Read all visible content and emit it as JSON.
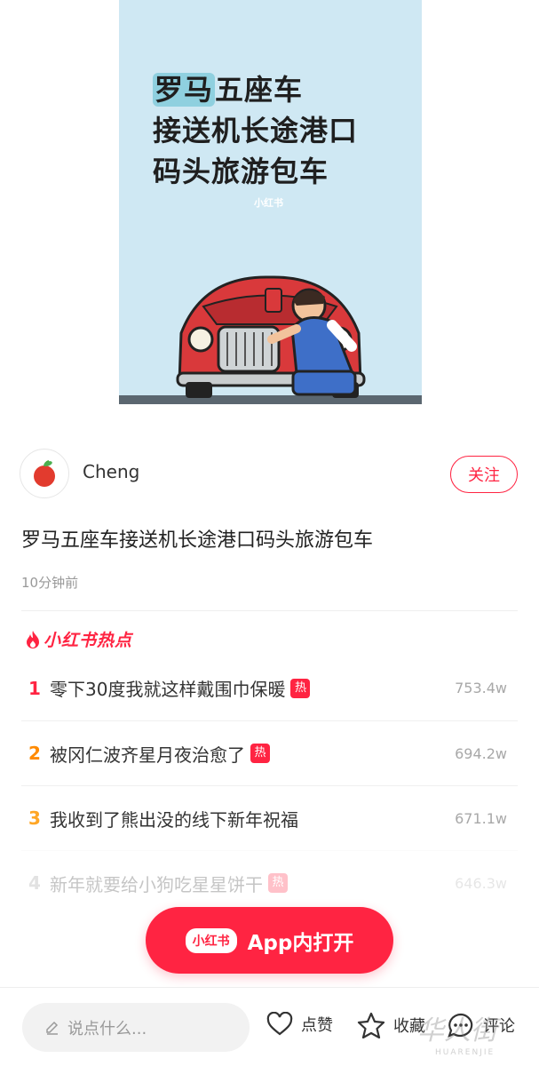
{
  "cover": {
    "line1_highlight": "罗马",
    "line1_rest": "五座车",
    "line2": "接送机长途港口",
    "line3": "码头旅游包车",
    "watermark": "小红书"
  },
  "author": {
    "name": "Cheng",
    "avatar_icon": "apple-icon",
    "follow_label": "关注"
  },
  "post": {
    "title": "罗马五座车接送机长途港口码头旅游包车",
    "time": "10分钟前"
  },
  "hot": {
    "header": "小红书热点",
    "items": [
      {
        "rank": "1",
        "text": "零下30度我就这样戴围巾保暖",
        "tag": "热",
        "count": "753.4w",
        "rank_color": "#ff2442"
      },
      {
        "rank": "2",
        "text": "被冈仁波齐星月夜治愈了",
        "tag": "热",
        "count": "694.2w",
        "rank_color": "#ff8a00"
      },
      {
        "rank": "3",
        "text": "我收到了熊出没的线下新年祝福",
        "tag": "",
        "count": "671.1w",
        "rank_color": "#ffa625"
      },
      {
        "rank": "4",
        "text": "新年就要给小狗吃星星饼干",
        "tag": "热",
        "count": "646.3w",
        "rank_color": "#999999"
      }
    ]
  },
  "open_app": {
    "logo": "小红书",
    "label": "App内打开"
  },
  "bottom": {
    "comment_placeholder": "说点什么...",
    "like_label": "点赞",
    "collect_label": "收藏",
    "comment_label": "评论"
  },
  "watermark": {
    "cn": "华人街",
    "en": "HUARENJIE"
  },
  "colors": {
    "brand": "#ff2442",
    "cover_bg": "#cfe8f3"
  }
}
